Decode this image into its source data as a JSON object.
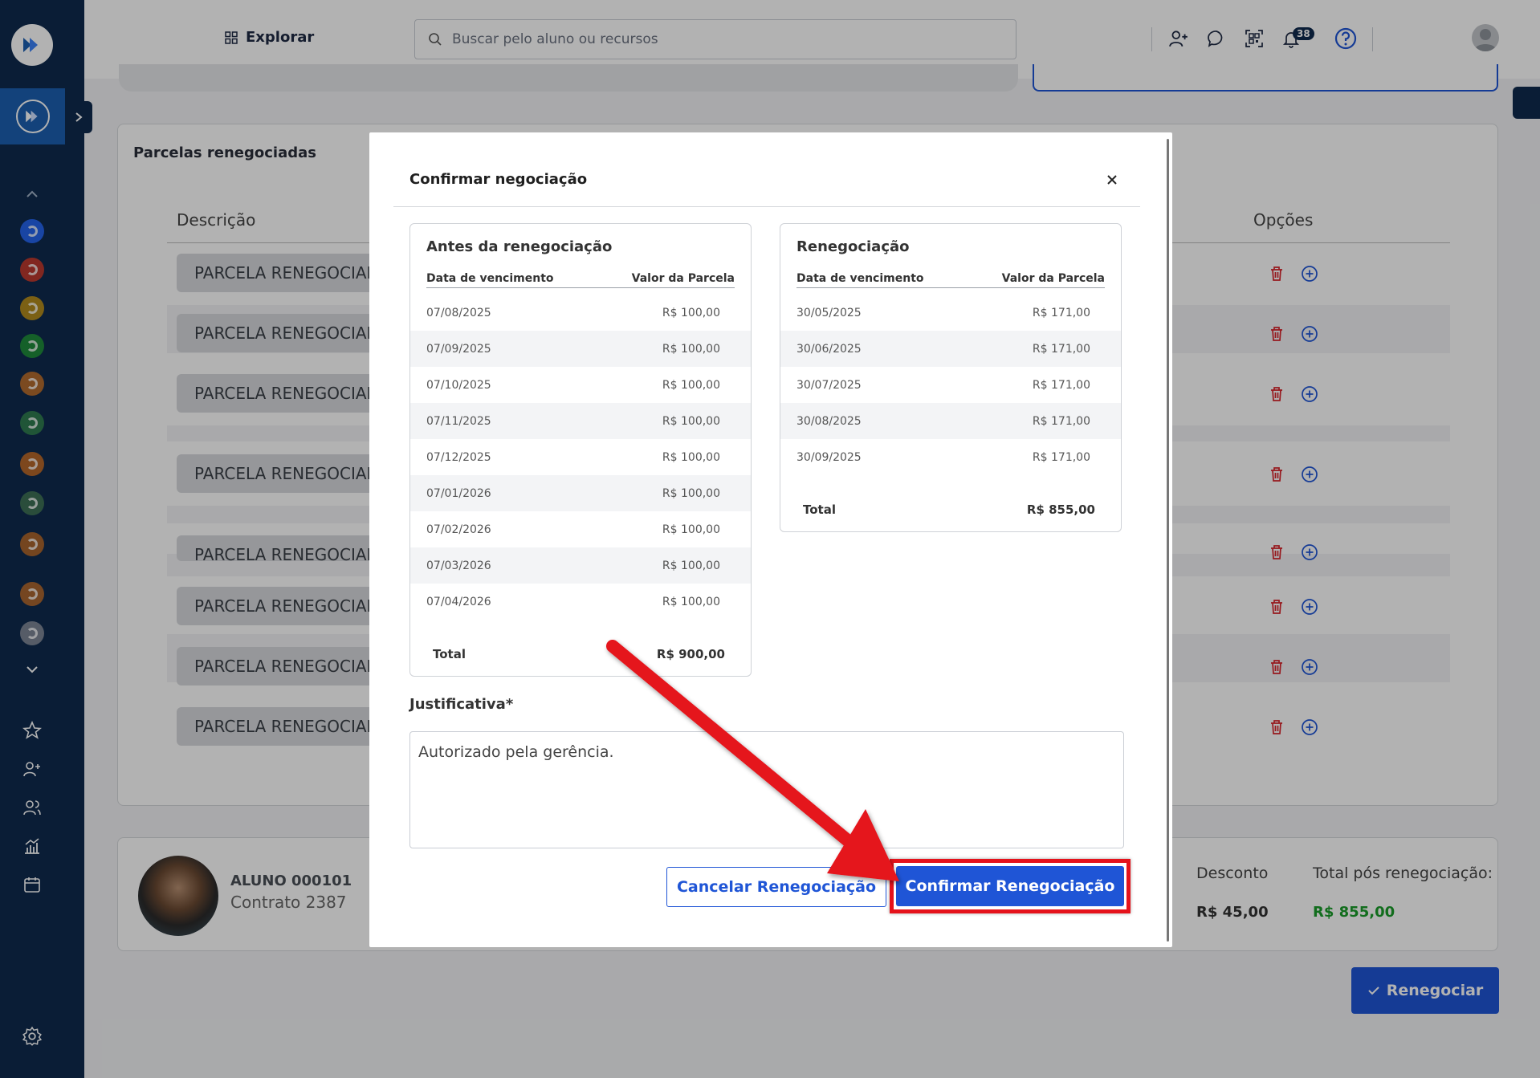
{
  "topbar": {
    "explore_label": "Explorar",
    "search_placeholder": "Buscar pelo aluno ou recursos",
    "notifications_count": "38"
  },
  "page": {
    "section_title": "Parcelas renegociadas",
    "columns": {
      "description": "Descrição",
      "options": "Opções"
    },
    "installment_rows": [
      "PARCELA RENEGOCIADA",
      "PARCELA RENEGOCIADA",
      "PARCELA RENEGOCIADA",
      "PARCELA RENEGOCIADA",
      "PARCELA RENEGOCIADA",
      "PARCELA RENEGOCIADA",
      "PARCELA RENEGOCIADA",
      "PARCELA RENEGOCIADA"
    ],
    "student": {
      "name": "ALUNO 000101",
      "contract": "Contrato 2387"
    },
    "summary": {
      "discount_label": "Desconto",
      "discount_value": "R$ 45,00",
      "total_label": "Total pós renegociação:",
      "total_value": "R$ 855,00"
    },
    "renegotiate_button": "Renegociar"
  },
  "modal": {
    "title": "Confirmar negociação",
    "before": {
      "title": "Antes da renegociação",
      "col_date": "Data de vencimento",
      "col_value": "Valor da Parcela",
      "rows": [
        {
          "date": "07/08/2025",
          "value": "R$ 100,00"
        },
        {
          "date": "07/09/2025",
          "value": "R$ 100,00"
        },
        {
          "date": "07/10/2025",
          "value": "R$ 100,00"
        },
        {
          "date": "07/11/2025",
          "value": "R$ 100,00"
        },
        {
          "date": "07/12/2025",
          "value": "R$ 100,00"
        },
        {
          "date": "07/01/2026",
          "value": "R$ 100,00"
        },
        {
          "date": "07/02/2026",
          "value": "R$ 100,00"
        },
        {
          "date": "07/03/2026",
          "value": "R$ 100,00"
        },
        {
          "date": "07/04/2026",
          "value": "R$ 100,00"
        }
      ],
      "total_label": "Total",
      "total_value": "R$ 900,00"
    },
    "after": {
      "title": "Renegociação",
      "col_date": "Data de vencimento",
      "col_value": "Valor da Parcela",
      "rows": [
        {
          "date": "30/05/2025",
          "value": "R$ 171,00"
        },
        {
          "date": "30/06/2025",
          "value": "R$ 171,00"
        },
        {
          "date": "30/07/2025",
          "value": "R$ 171,00"
        },
        {
          "date": "30/08/2025",
          "value": "R$ 171,00"
        },
        {
          "date": "30/09/2025",
          "value": "R$ 171,00"
        }
      ],
      "total_label": "Total",
      "total_value": "R$ 855,00"
    },
    "justification_label": "Justificativa*",
    "justification_value": "Autorizado pela gerência.",
    "cancel_button": "Cancelar Renegociação",
    "confirm_button": "Confirmar Renegociação"
  },
  "colors": {
    "sidebar": "#0f2a4e",
    "primary": "#1f55d6",
    "highlight_red": "#e5121b",
    "delete_red": "#d9242b",
    "total_green": "#1a9c2a"
  }
}
